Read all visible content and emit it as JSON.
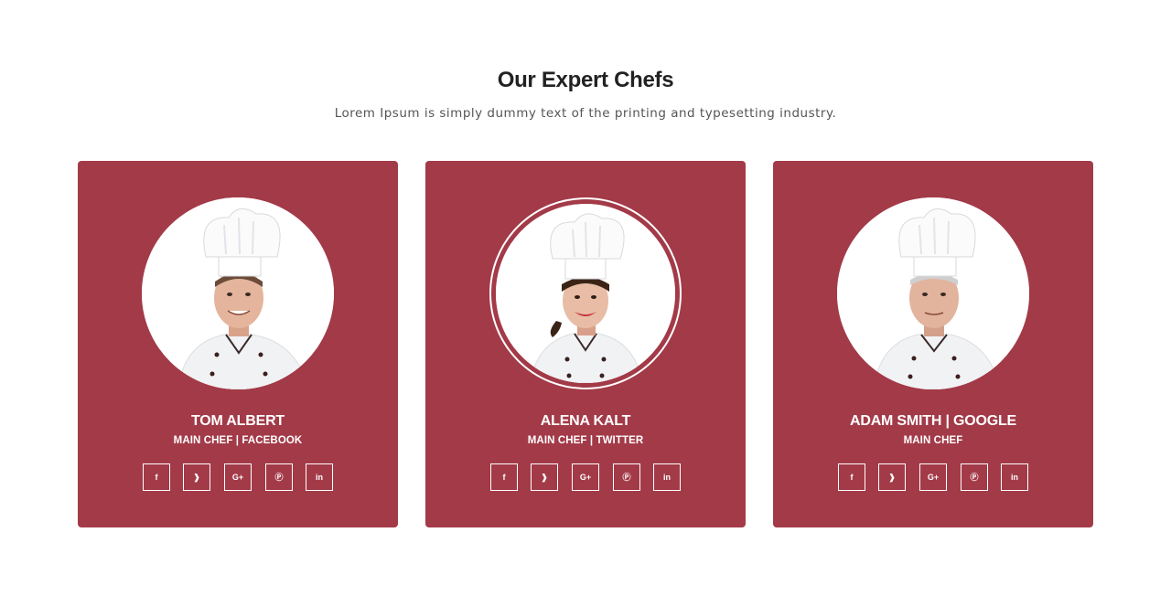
{
  "section": {
    "title": "Our Expert Chefs",
    "subtitle": "Lorem Ipsum is simply dummy text of the printing and typesetting industry."
  },
  "social_icons": [
    "facebook-icon",
    "twitter-icon",
    "google-plus-icon",
    "pinterest-icon",
    "linkedin-icon"
  ],
  "social_glyphs": [
    "f",
    "❱",
    "G+",
    "Ⓟ",
    "in"
  ],
  "chefs": [
    {
      "name": "TOM ALBERT",
      "role": "MAIN CHEF | FACEBOOK"
    },
    {
      "name": "ALENA KALT",
      "role": "MAIN CHEF | TWITTER"
    },
    {
      "name": "ADAM SMITH | GOOGLE",
      "role": "MAIN CHEF"
    }
  ],
  "colors": {
    "card_bg": "#a33a48",
    "title": "#222222",
    "subtitle": "#555555"
  }
}
